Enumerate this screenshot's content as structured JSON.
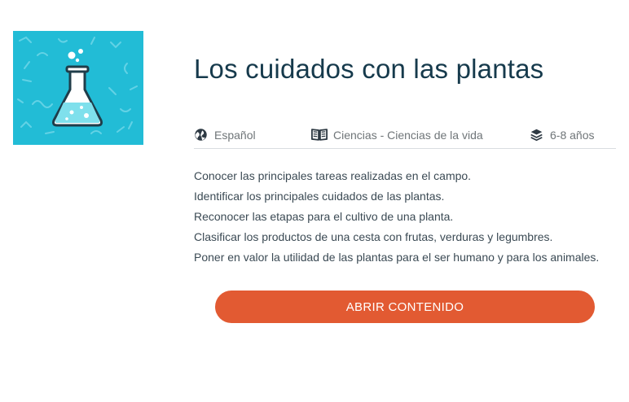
{
  "thumbnail": {
    "icon": "flask-icon",
    "background_color": "#22bcd6"
  },
  "title": "Los cuidados con las plantas",
  "meta": {
    "language": {
      "icon": "globe-icon",
      "label": "Español"
    },
    "subject": {
      "icon": "book-icon",
      "label": "Ciencias - Ciencias de la vida"
    },
    "age": {
      "icon": "layers-icon",
      "label": "6-8 años"
    }
  },
  "objectives": [
    "Conocer las principales tareas realizadas en el campo.",
    "Identificar los principales cuidados de las plantas.",
    "Reconocer las etapas para el cultivo de una planta.",
    "Clasificar los productos de una cesta con frutas, verduras y legumbres.",
    "Poner en valor la utilidad de las plantas para el ser humano y para los animales."
  ],
  "open_button": {
    "label": "ABRIR CONTENIDO",
    "color": "#e25a32"
  },
  "colors": {
    "title": "#163a4c",
    "text": "#3b4a54",
    "muted": "#6f7578"
  }
}
